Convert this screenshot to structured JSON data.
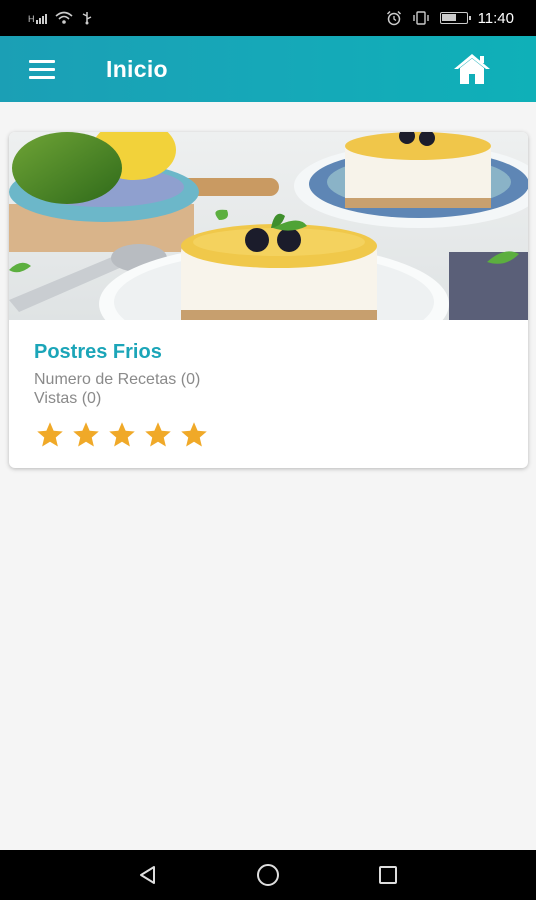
{
  "status_bar": {
    "network_label": "H",
    "time": "11:40",
    "icons": [
      "signal-icon",
      "wifi-icon",
      "usb-icon",
      "alarm-icon",
      "vibrate-icon",
      "battery-icon"
    ]
  },
  "app_bar": {
    "title": "Inicio",
    "menu_icon": "menu-icon",
    "home_icon": "home-icon"
  },
  "categories": [
    {
      "title": "Postres Frios",
      "recipes_text": "Numero de Recetas (0)",
      "views_text": "Vistas (0)",
      "rating": 5,
      "rating_max": 5
    }
  ],
  "colors": {
    "app_bar": "#16a8b8",
    "accent_title": "#1ba5b8",
    "star": "#f0a928",
    "secondary_text": "#8a8a8a"
  },
  "nav_bar": {
    "icons": [
      "back-icon",
      "home-circle-icon",
      "recents-icon"
    ]
  }
}
